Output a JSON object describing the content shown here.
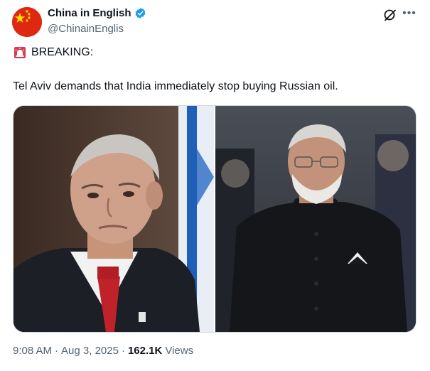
{
  "author": {
    "display_name": "China in English",
    "handle": "@ChinainEnglis"
  },
  "icons": {
    "avatar": "china-flag",
    "verified": "verified-badge-icon",
    "grok": "grok-icon",
    "more": "more-icon",
    "siren": "rotating-light-icon"
  },
  "colors": {
    "verified_blue": "#1d9bf0",
    "flag_red": "#de2910",
    "flag_yellow": "#ffde00",
    "secondary_text": "#536471"
  },
  "tweet": {
    "line1": "BREAKING:",
    "line2": "Tel Aviv demands that India immediately stop buying Russian oil."
  },
  "media": {
    "count": 2
  },
  "meta": {
    "time": "9:08 AM",
    "separator": "·",
    "date": "Aug 3, 2025",
    "views_count": "162.1K",
    "views_label": "Views"
  }
}
